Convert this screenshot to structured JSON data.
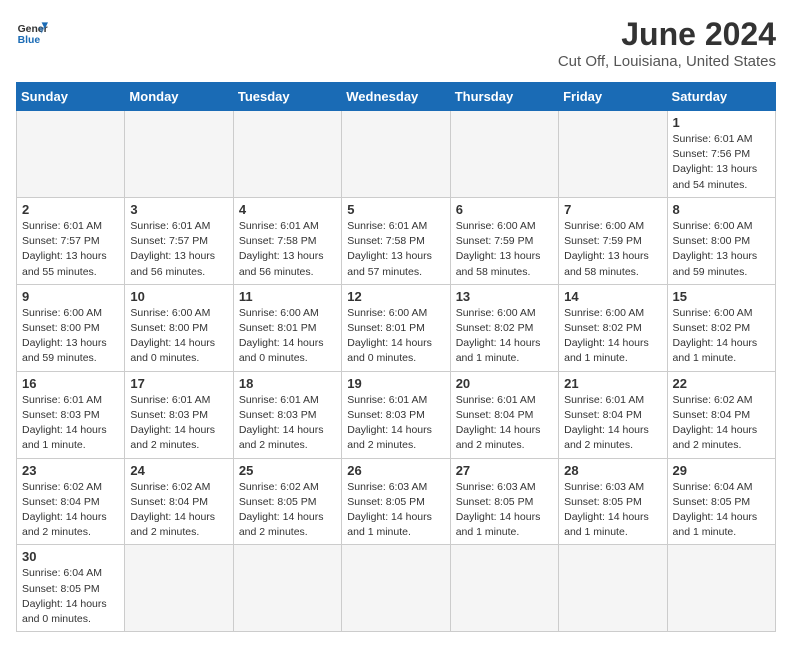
{
  "header": {
    "logo_general": "General",
    "logo_blue": "Blue",
    "title": "June 2024",
    "subtitle": "Cut Off, Louisiana, United States"
  },
  "days_of_week": [
    "Sunday",
    "Monday",
    "Tuesday",
    "Wednesday",
    "Thursday",
    "Friday",
    "Saturday"
  ],
  "weeks": [
    [
      {
        "day": "",
        "empty": true
      },
      {
        "day": "",
        "empty": true
      },
      {
        "day": "",
        "empty": true
      },
      {
        "day": "",
        "empty": true
      },
      {
        "day": "",
        "empty": true
      },
      {
        "day": "",
        "empty": true
      },
      {
        "day": "1",
        "sunrise": "Sunrise: 6:01 AM",
        "sunset": "Sunset: 7:56 PM",
        "daylight": "Daylight: 13 hours and 54 minutes."
      }
    ],
    [
      {
        "day": "2",
        "sunrise": "Sunrise: 6:01 AM",
        "sunset": "Sunset: 7:57 PM",
        "daylight": "Daylight: 13 hours and 55 minutes."
      },
      {
        "day": "3",
        "sunrise": "Sunrise: 6:01 AM",
        "sunset": "Sunset: 7:57 PM",
        "daylight": "Daylight: 13 hours and 56 minutes."
      },
      {
        "day": "4",
        "sunrise": "Sunrise: 6:01 AM",
        "sunset": "Sunset: 7:58 PM",
        "daylight": "Daylight: 13 hours and 56 minutes."
      },
      {
        "day": "5",
        "sunrise": "Sunrise: 6:01 AM",
        "sunset": "Sunset: 7:58 PM",
        "daylight": "Daylight: 13 hours and 57 minutes."
      },
      {
        "day": "6",
        "sunrise": "Sunrise: 6:00 AM",
        "sunset": "Sunset: 7:59 PM",
        "daylight": "Daylight: 13 hours and 58 minutes."
      },
      {
        "day": "7",
        "sunrise": "Sunrise: 6:00 AM",
        "sunset": "Sunset: 7:59 PM",
        "daylight": "Daylight: 13 hours and 58 minutes."
      },
      {
        "day": "8",
        "sunrise": "Sunrise: 6:00 AM",
        "sunset": "Sunset: 8:00 PM",
        "daylight": "Daylight: 13 hours and 59 minutes."
      }
    ],
    [
      {
        "day": "9",
        "sunrise": "Sunrise: 6:00 AM",
        "sunset": "Sunset: 8:00 PM",
        "daylight": "Daylight: 13 hours and 59 minutes."
      },
      {
        "day": "10",
        "sunrise": "Sunrise: 6:00 AM",
        "sunset": "Sunset: 8:00 PM",
        "daylight": "Daylight: 14 hours and 0 minutes."
      },
      {
        "day": "11",
        "sunrise": "Sunrise: 6:00 AM",
        "sunset": "Sunset: 8:01 PM",
        "daylight": "Daylight: 14 hours and 0 minutes."
      },
      {
        "day": "12",
        "sunrise": "Sunrise: 6:00 AM",
        "sunset": "Sunset: 8:01 PM",
        "daylight": "Daylight: 14 hours and 0 minutes."
      },
      {
        "day": "13",
        "sunrise": "Sunrise: 6:00 AM",
        "sunset": "Sunset: 8:02 PM",
        "daylight": "Daylight: 14 hours and 1 minute."
      },
      {
        "day": "14",
        "sunrise": "Sunrise: 6:00 AM",
        "sunset": "Sunset: 8:02 PM",
        "daylight": "Daylight: 14 hours and 1 minute."
      },
      {
        "day": "15",
        "sunrise": "Sunrise: 6:00 AM",
        "sunset": "Sunset: 8:02 PM",
        "daylight": "Daylight: 14 hours and 1 minute."
      }
    ],
    [
      {
        "day": "16",
        "sunrise": "Sunrise: 6:01 AM",
        "sunset": "Sunset: 8:03 PM",
        "daylight": "Daylight: 14 hours and 1 minute."
      },
      {
        "day": "17",
        "sunrise": "Sunrise: 6:01 AM",
        "sunset": "Sunset: 8:03 PM",
        "daylight": "Daylight: 14 hours and 2 minutes."
      },
      {
        "day": "18",
        "sunrise": "Sunrise: 6:01 AM",
        "sunset": "Sunset: 8:03 PM",
        "daylight": "Daylight: 14 hours and 2 minutes."
      },
      {
        "day": "19",
        "sunrise": "Sunrise: 6:01 AM",
        "sunset": "Sunset: 8:03 PM",
        "daylight": "Daylight: 14 hours and 2 minutes."
      },
      {
        "day": "20",
        "sunrise": "Sunrise: 6:01 AM",
        "sunset": "Sunset: 8:04 PM",
        "daylight": "Daylight: 14 hours and 2 minutes."
      },
      {
        "day": "21",
        "sunrise": "Sunrise: 6:01 AM",
        "sunset": "Sunset: 8:04 PM",
        "daylight": "Daylight: 14 hours and 2 minutes."
      },
      {
        "day": "22",
        "sunrise": "Sunrise: 6:02 AM",
        "sunset": "Sunset: 8:04 PM",
        "daylight": "Daylight: 14 hours and 2 minutes."
      }
    ],
    [
      {
        "day": "23",
        "sunrise": "Sunrise: 6:02 AM",
        "sunset": "Sunset: 8:04 PM",
        "daylight": "Daylight: 14 hours and 2 minutes."
      },
      {
        "day": "24",
        "sunrise": "Sunrise: 6:02 AM",
        "sunset": "Sunset: 8:04 PM",
        "daylight": "Daylight: 14 hours and 2 minutes."
      },
      {
        "day": "25",
        "sunrise": "Sunrise: 6:02 AM",
        "sunset": "Sunset: 8:05 PM",
        "daylight": "Daylight: 14 hours and 2 minutes."
      },
      {
        "day": "26",
        "sunrise": "Sunrise: 6:03 AM",
        "sunset": "Sunset: 8:05 PM",
        "daylight": "Daylight: 14 hours and 1 minute."
      },
      {
        "day": "27",
        "sunrise": "Sunrise: 6:03 AM",
        "sunset": "Sunset: 8:05 PM",
        "daylight": "Daylight: 14 hours and 1 minute."
      },
      {
        "day": "28",
        "sunrise": "Sunrise: 6:03 AM",
        "sunset": "Sunset: 8:05 PM",
        "daylight": "Daylight: 14 hours and 1 minute."
      },
      {
        "day": "29",
        "sunrise": "Sunrise: 6:04 AM",
        "sunset": "Sunset: 8:05 PM",
        "daylight": "Daylight: 14 hours and 1 minute."
      }
    ],
    [
      {
        "day": "30",
        "sunrise": "Sunrise: 6:04 AM",
        "sunset": "Sunset: 8:05 PM",
        "daylight": "Daylight: 14 hours and 0 minutes."
      },
      {
        "day": "",
        "empty": true
      },
      {
        "day": "",
        "empty": true
      },
      {
        "day": "",
        "empty": true
      },
      {
        "day": "",
        "empty": true
      },
      {
        "day": "",
        "empty": true
      },
      {
        "day": "",
        "empty": true
      }
    ]
  ]
}
